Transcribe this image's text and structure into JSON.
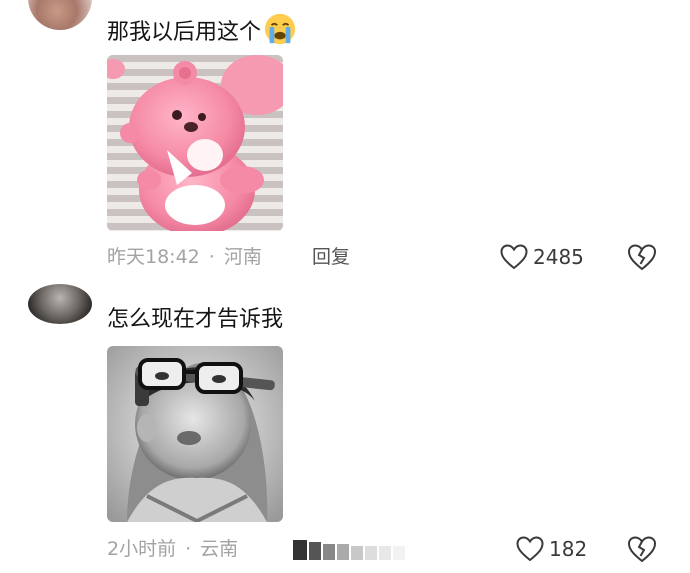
{
  "comments": [
    {
      "text": "那我以后用这个",
      "emoji": "loudly-crying-face-emoji",
      "time": "昨天18:42",
      "location": "河南",
      "reply_label": "回复",
      "likes": "2485"
    },
    {
      "text": "怎么现在才告诉我",
      "time": "2小时前",
      "location": "云南",
      "likes": "182"
    }
  ],
  "separator": "·",
  "icons": {
    "like": "heart-outline-icon",
    "dislike": "broken-heart-icon"
  },
  "colors": {
    "meta_text": "#a3a3a3",
    "body_text": "#151515",
    "icon": "#3a3a3a"
  }
}
